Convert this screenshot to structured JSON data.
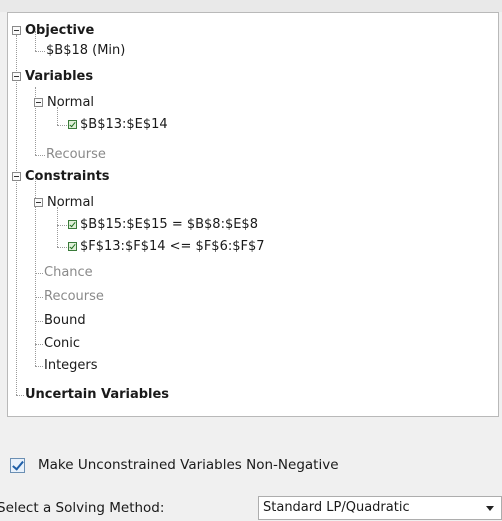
{
  "tree": {
    "objective": "Objective",
    "objective_cell": "$B$18 (Min)",
    "variables": "Variables",
    "variables_normal": "Normal",
    "variables_normal_item": "$B$13:$E$14",
    "variables_recourse": "Recourse",
    "constraints": "Constraints",
    "constraints_normal": "Normal",
    "constraint_1": "$B$15:$E$15 = $B$8:$E$8",
    "constraint_2": "$F$13:$F$14 <= $F$6:$F$7",
    "chance": "Chance",
    "constraints_recourse": "Recourse",
    "bound": "Bound",
    "conic": "Conic",
    "integers": "Integers",
    "uncertain_variables": "Uncertain Variables"
  },
  "options": {
    "nonneg_label": "Make Unconstrained Variables Non-Negative",
    "nonneg_checked": true,
    "method_label": "Select a Solving Method:",
    "method_value": "Standard LP/Quadratic"
  },
  "colors": {
    "checkbox_tree": "#1f6f1f",
    "checkbox_main": "#1f5fa8",
    "disabled_text": "#8a8a8a"
  }
}
